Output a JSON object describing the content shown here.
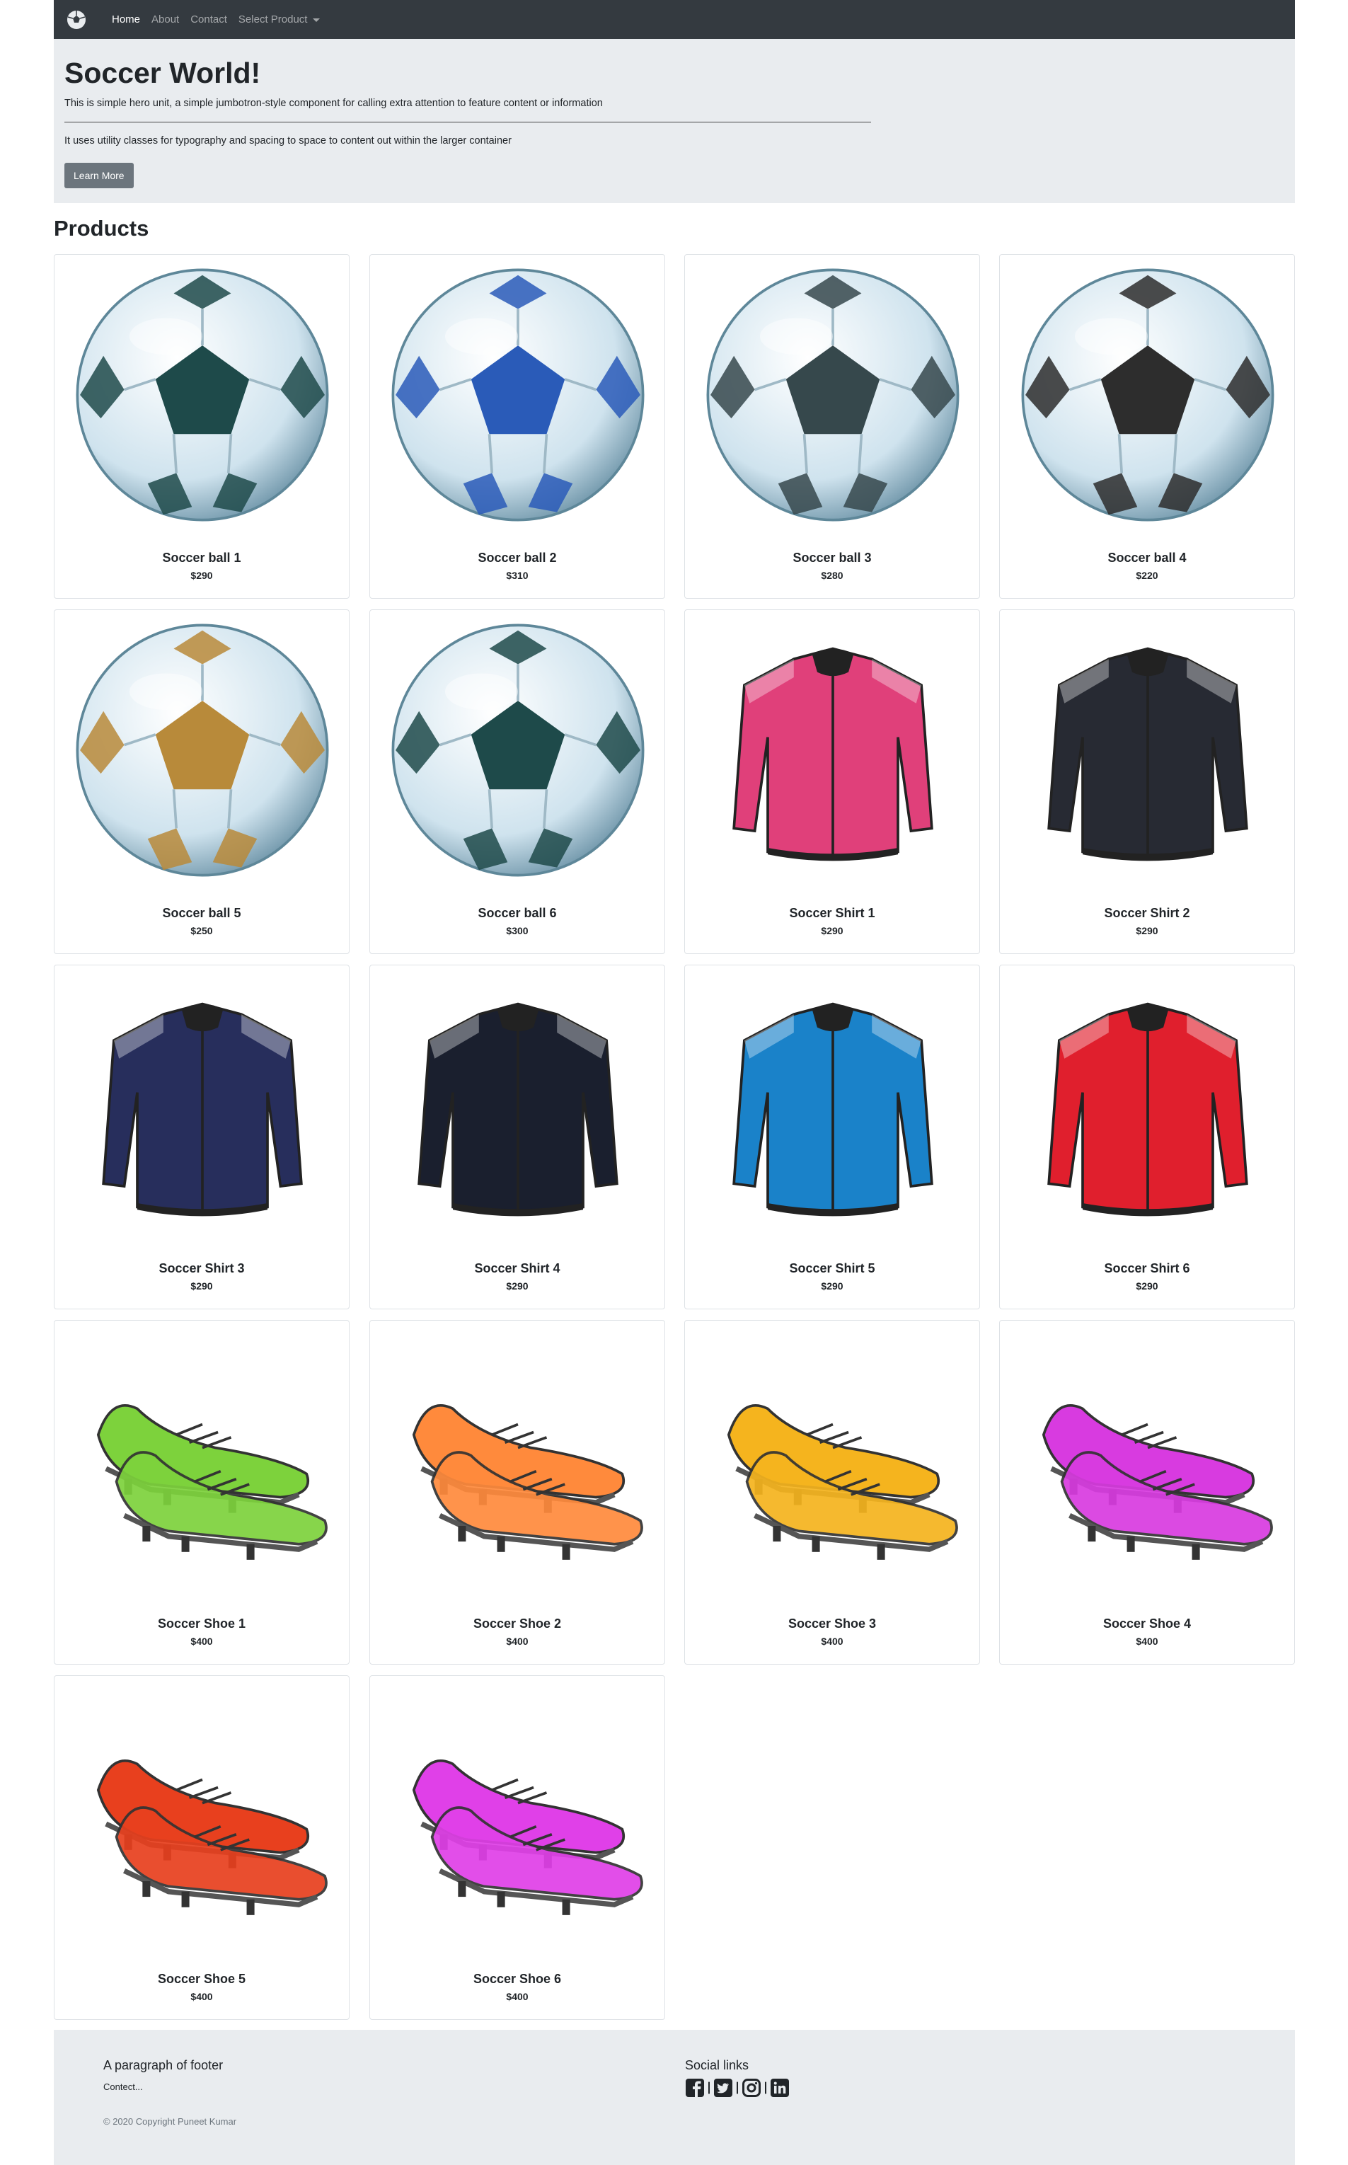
{
  "navbar": {
    "brand_icon": "soccer-ball-icon",
    "links": [
      "Home",
      "About",
      "Contact"
    ],
    "dropdown_label": "Select Product"
  },
  "jumbotron": {
    "title": "Soccer World!",
    "lead": "This is simple hero unit, a simple jumbotron-style component for calling extra attention to feature content or information",
    "text": "It uses utility classes for typography and spacing to space to content out within the larger container",
    "button": "Learn More"
  },
  "products_title": "Products",
  "products": [
    {
      "name": "Soccer ball 1",
      "price": "$290",
      "kind": "ball",
      "color": "#1e4a4a"
    },
    {
      "name": "Soccer ball 2",
      "price": "$310",
      "kind": "ball",
      "color": "#2a5bb8"
    },
    {
      "name": "Soccer ball 3",
      "price": "$280",
      "kind": "ball",
      "color": "#36484c"
    },
    {
      "name": "Soccer ball 4",
      "price": "$220",
      "kind": "ball",
      "color": "#2d2d2d"
    },
    {
      "name": "Soccer ball 5",
      "price": "$250",
      "kind": "ball",
      "color": "#b88a3a"
    },
    {
      "name": "Soccer ball 6",
      "price": "$300",
      "kind": "ball",
      "color": "#1e4a4a"
    },
    {
      "name": "Soccer Shirt 1",
      "price": "$290",
      "kind": "shirt",
      "color": "#e0407a"
    },
    {
      "name": "Soccer Shirt 2",
      "price": "$290",
      "kind": "shirt",
      "color": "#272a33"
    },
    {
      "name": "Soccer Shirt 3",
      "price": "$290",
      "kind": "shirt",
      "color": "#272e5c"
    },
    {
      "name": "Soccer Shirt 4",
      "price": "$290",
      "kind": "shirt",
      "color": "#1a1f2e"
    },
    {
      "name": "Soccer Shirt 5",
      "price": "$290",
      "kind": "shirt",
      "color": "#1a82c9"
    },
    {
      "name": "Soccer Shirt 6",
      "price": "$290",
      "kind": "shirt",
      "color": "#e01f2d"
    },
    {
      "name": "Soccer Shoe 1",
      "price": "$400",
      "kind": "shoe",
      "color": "#7dd23c"
    },
    {
      "name": "Soccer Shoe 2",
      "price": "$400",
      "kind": "shoe",
      "color": "#ff8a3c"
    },
    {
      "name": "Soccer Shoe 3",
      "price": "$400",
      "kind": "shoe",
      "color": "#f5b41e"
    },
    {
      "name": "Soccer Shoe 4",
      "price": "$400",
      "kind": "shoe",
      "color": "#d83be0"
    },
    {
      "name": "Soccer Shoe 5",
      "price": "$400",
      "kind": "shoe",
      "color": "#e8401e"
    },
    {
      "name": "Soccer Shoe 6",
      "price": "$400",
      "kind": "shoe",
      "color": "#e040e8"
    }
  ],
  "footer": {
    "paragraph": "A paragraph of footer",
    "contact": "Contect...",
    "copyright": "© 2020 Copyright Puneet Kumar",
    "social_title": "Social links",
    "social_icons": [
      "facebook-icon",
      "twitter-icon",
      "instagram-icon",
      "linkedin-icon"
    ]
  }
}
